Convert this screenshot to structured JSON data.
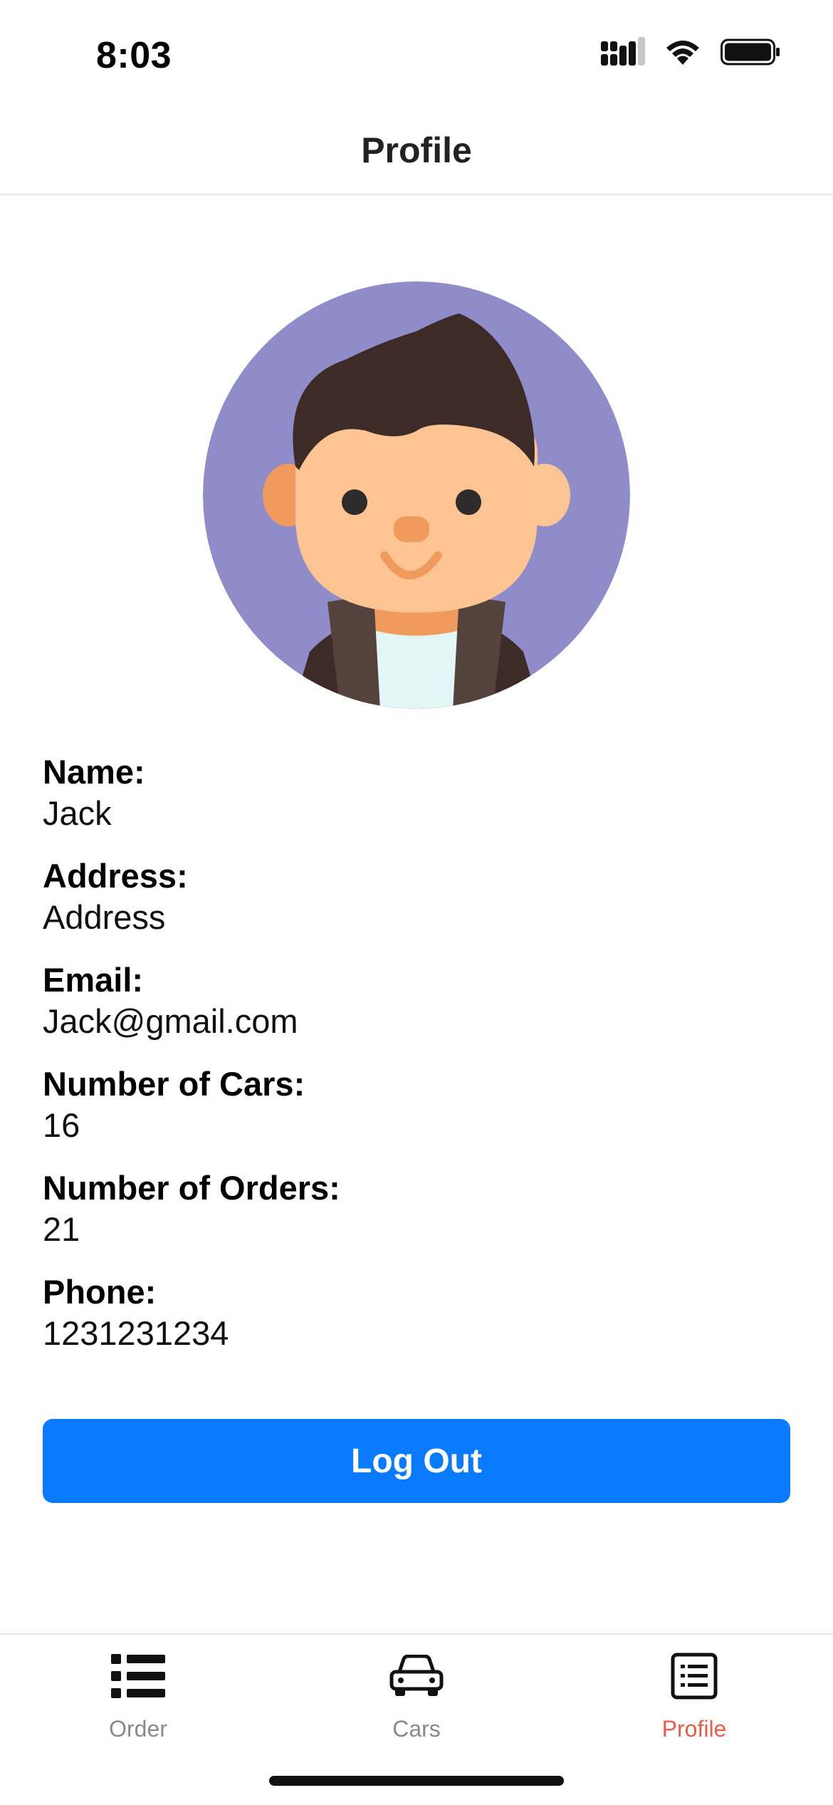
{
  "status_bar": {
    "time": "8:03",
    "signal_icon": "signal-icon",
    "wifi_icon": "wifi-icon",
    "battery_icon": "battery-icon"
  },
  "header": {
    "title": "Profile"
  },
  "avatar": {
    "icon": "user-avatar-illustration",
    "background_color": "#8f8cc9"
  },
  "fields": [
    {
      "label": "Name:",
      "value": "Jack"
    },
    {
      "label": "Address:",
      "value": "Address"
    },
    {
      "label": "Email:",
      "value": "Jack@gmail.com"
    },
    {
      "label": "Number of Cars:",
      "value": "16"
    },
    {
      "label": "Number of Orders:",
      "value": "21"
    },
    {
      "label": "Phone:",
      "value": "1231231234"
    }
  ],
  "logout": {
    "label": "Log Out",
    "color": "#0a7bff"
  },
  "tab_bar": {
    "tabs": [
      {
        "label": "Order",
        "icon": "list-icon",
        "active": false
      },
      {
        "label": "Cars",
        "icon": "car-icon",
        "active": false
      },
      {
        "label": "Profile",
        "icon": "document-list-icon",
        "active": true
      }
    ],
    "active_color": "#f05a4a",
    "inactive_color": "#8a8a8a"
  }
}
